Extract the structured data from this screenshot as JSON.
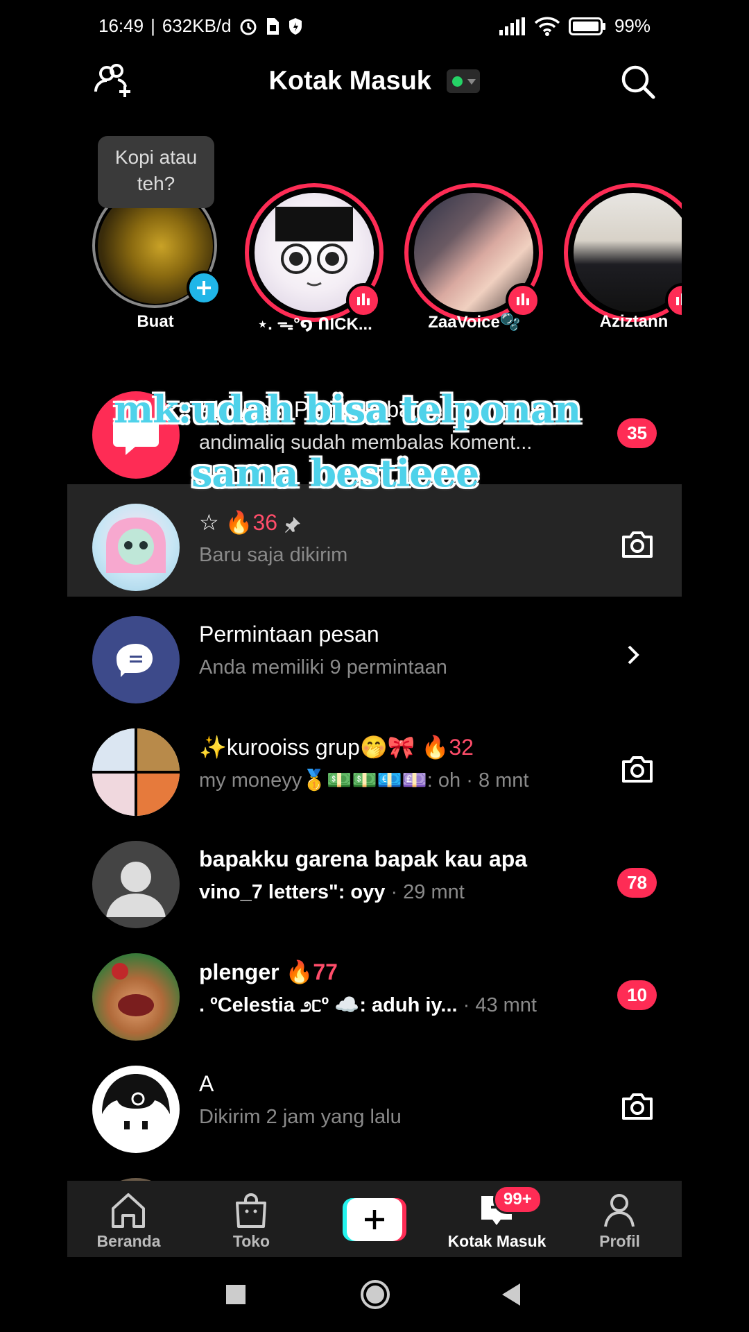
{
  "status": {
    "time": "16:49",
    "net": "632KB/d",
    "battery": "99%"
  },
  "header": {
    "title": "Kotak Masuk"
  },
  "stories": [
    {
      "name": "Buat",
      "tooltip": "Kopi atau teh?"
    },
    {
      "name": "⋆. ᯓ°໑ ՈIСK..."
    },
    {
      "name": "ZaaVoice🫧"
    },
    {
      "name": "Aziztann"
    }
  ],
  "rows": [
    {
      "title": "Aktivitas: Pengikut baru",
      "sub": "andimaliq sudah membalas koment...",
      "badge": "35"
    },
    {
      "title_star": "☆",
      "streak": "36",
      "sub": "Baru saja dikirim"
    },
    {
      "title": "Permintaan pesan",
      "sub": "Anda memiliki 9 permintaan"
    },
    {
      "title": "✨kurooiss grup🤭🎀",
      "streak": "32",
      "sub": "my moneyy🥇💵💵💶💷: oh · 8 mnt"
    },
    {
      "title": "bapakku garena bapak kau apa",
      "sub_bold": "vino_7 letters\": oyy",
      "sub_time": " · 29 mnt",
      "badge": "78"
    },
    {
      "title": "plenger",
      "streak": "77",
      "sub_bold": ". ºCelestia ೨ᥴº ☁️: aduh iy...",
      "sub_time": " · 43 mnt",
      "badge": "10"
    },
    {
      "title": "A",
      "sub": "Dikirim 2 jam yang lalu"
    }
  ],
  "overlay": {
    "line1": "mk:udah bisa telponan",
    "line2": "sama bestieee"
  },
  "tabs": {
    "home": "Beranda",
    "shop": "Toko",
    "inbox": "Kotak Masuk",
    "inbox_badge": "99+",
    "profile": "Profil"
  }
}
